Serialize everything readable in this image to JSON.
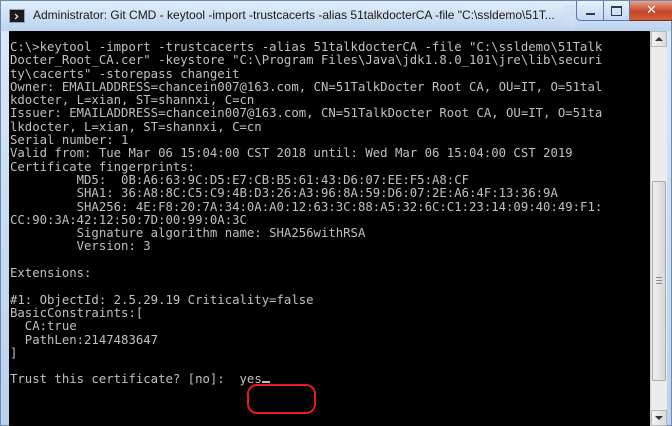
{
  "window": {
    "title": "Administrator: Git CMD - keytool  -import -trustcacerts -alias 51talkdocterCA -file \"C:\\ssldemo\\51T...",
    "app_icon": "cmd-prompt-icon",
    "controls": {
      "minimize_icon": "minimize-icon",
      "maximize_icon": "maximize-icon",
      "close_icon": "close-icon",
      "close_symbol": "✕",
      "close_color": "#c7452a"
    }
  },
  "console": {
    "background": "#000000",
    "foreground": "#c0c0c0",
    "lines": [
      "C:\\>keytool -import -trustcacerts -alias 51talkdocterCA -file \"C:\\ssldemo\\51Talk",
      "Docter_Root_CA.cer\" -keystore \"C:\\Program Files\\Java\\jdk1.8.0_101\\jre\\lib\\securi",
      "ty\\cacerts\" -storepass changeit",
      "Owner: EMAILADDRESS=chancein007@163.com, CN=51TalkDocter Root CA, OU=IT, O=51tal",
      "kdocter, L=xian, ST=shannxi, C=cn",
      "Issuer: EMAILADDRESS=chancein007@163.com, CN=51TalkDocter Root CA, OU=IT, O=51ta",
      "lkdocter, L=xian, ST=shannxi, C=cn",
      "Serial number: 1",
      "Valid from: Tue Mar 06 15:04:00 CST 2018 until: Wed Mar 06 15:04:00 CST 2019",
      "Certificate fingerprints:",
      "         MD5:  0B:A6:63:9C:D5:E7:CB:B5:61:43:D6:07:EE:F5:A8:CF",
      "         SHA1: 36:A8:8C:C5:C9:4B:D3:26:A3:96:8A:59:D6:07:2E:A6:4F:13:36:9A",
      "         SHA256: 4E:F8:20:7A:34:0A:A0:12:63:3C:88:A5:32:6C:C1:23:14:09:40:49:F1:",
      "CC:90:3A:42:12:50:7D:00:99:0A:3C",
      "         Signature algorithm name: SHA256withRSA",
      "         Version: 3",
      "",
      "Extensions:",
      "",
      "#1: ObjectId: 2.5.29.19 Criticality=false",
      "BasicConstraints:[",
      "  CA:true",
      "  PathLen:2147483647",
      "]",
      ""
    ],
    "prompt": "Trust this certificate? [no]:  ",
    "input_value": "yes",
    "highlight_color": "#e8191f"
  },
  "scrollbar": {
    "up_icon": "scroll-up-arrow-icon",
    "down_icon": "scroll-down-arrow-icon"
  }
}
